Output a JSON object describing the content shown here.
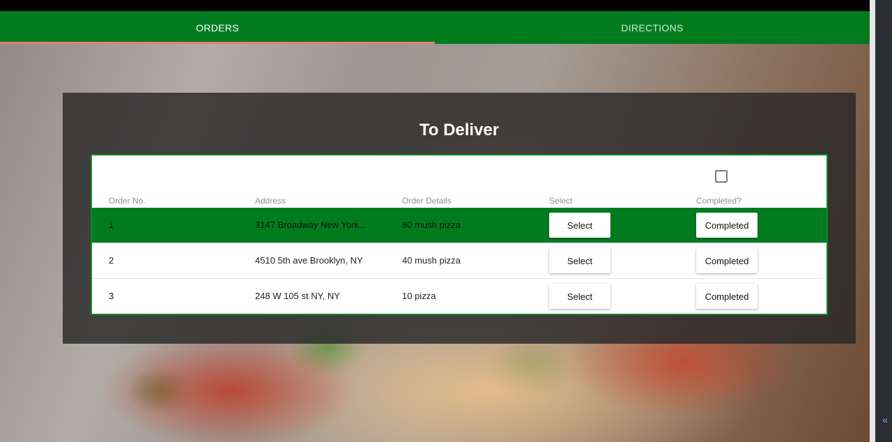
{
  "tabs": [
    {
      "label": "ORDERS",
      "active": true
    },
    {
      "label": "DIRECTIONS",
      "active": false
    }
  ],
  "panel": {
    "title": "To Deliver"
  },
  "table": {
    "headers": [
      "Order No.",
      "Address",
      "Order Details",
      "Select",
      "Completed?"
    ],
    "rows": [
      {
        "order_no": "1",
        "address": "3147 Broadway New York...",
        "details": "80 mush pizza",
        "select_label": "Select",
        "completed_label": "Completed",
        "selected": true
      },
      {
        "order_no": "2",
        "address": "4510 5th ave Brooklyn, NY",
        "details": "40 mush pizza",
        "select_label": "Select",
        "completed_label": "Completed",
        "selected": false
      },
      {
        "order_no": "3",
        "address": "248 W 105 st NY, NY",
        "details": "10 pizza",
        "select_label": "Select",
        "completed_label": "Completed",
        "selected": false
      }
    ]
  },
  "side": {
    "glyph": "«"
  },
  "colors": {
    "accent": "#007c1f",
    "tab_indicator": "#f07a7a",
    "table_border": "#0a8a2a"
  }
}
